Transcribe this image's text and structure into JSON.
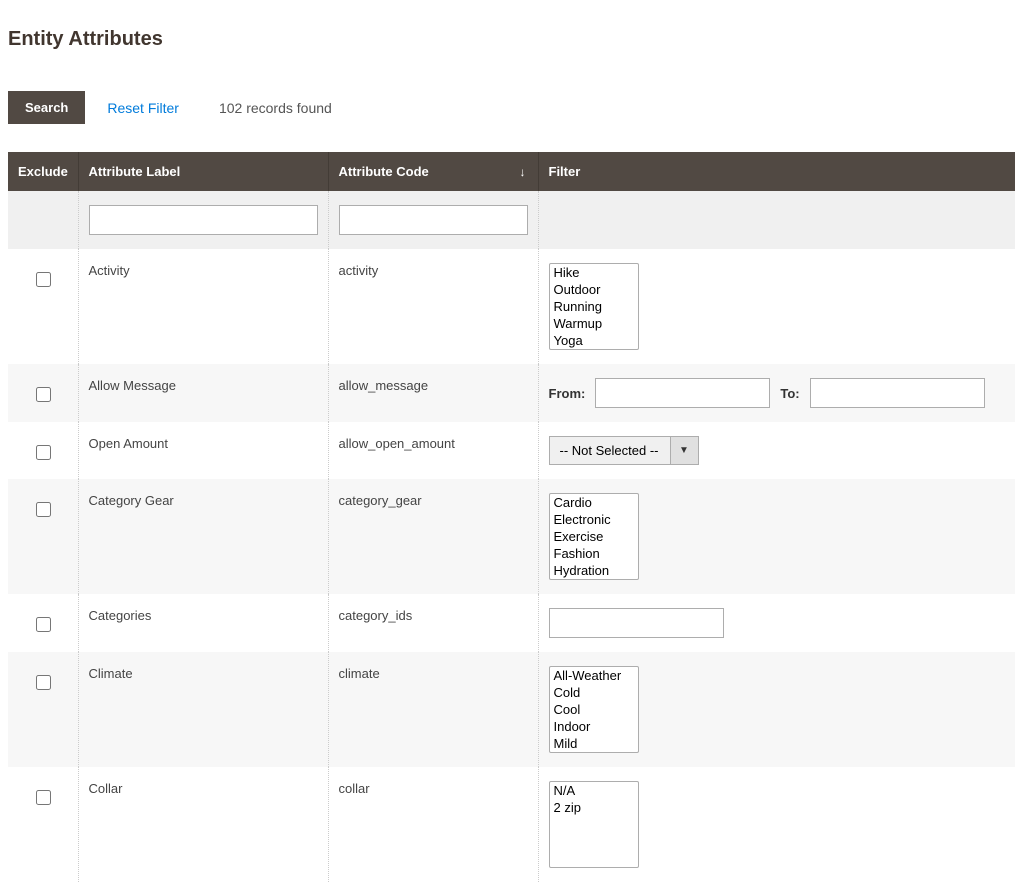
{
  "page": {
    "title": "Entity Attributes"
  },
  "toolbar": {
    "search_label": "Search",
    "reset_label": "Reset Filter",
    "records_found": "102 records found"
  },
  "headers": {
    "exclude": "Exclude",
    "attribute_label": "Attribute Label",
    "attribute_code": "Attribute Code",
    "filter": "Filter"
  },
  "range": {
    "from_label": "From:",
    "to_label": "To:"
  },
  "select_placeholder": "-- Not Selected --",
  "rows": [
    {
      "label": "Activity",
      "code": "activity",
      "filter_type": "multiselect",
      "options": [
        "Hike",
        "Outdoor",
        "Running",
        "Warmup",
        "Yoga"
      ]
    },
    {
      "label": "Allow Message",
      "code": "allow_message",
      "filter_type": "range"
    },
    {
      "label": "Open Amount",
      "code": "allow_open_amount",
      "filter_type": "select"
    },
    {
      "label": "Category Gear",
      "code": "category_gear",
      "filter_type": "multiselect",
      "options": [
        "Cardio",
        "Electronic",
        "Exercise",
        "Fashion",
        "Hydration"
      ]
    },
    {
      "label": "Categories",
      "code": "category_ids",
      "filter_type": "text"
    },
    {
      "label": "Climate",
      "code": "climate",
      "filter_type": "multiselect",
      "options": [
        "All-Weather",
        "Cold",
        "Cool",
        "Indoor",
        "Mild"
      ]
    },
    {
      "label": "Collar",
      "code": "collar",
      "filter_type": "multiselect",
      "options": [
        "N/A",
        "2 zip"
      ]
    }
  ]
}
